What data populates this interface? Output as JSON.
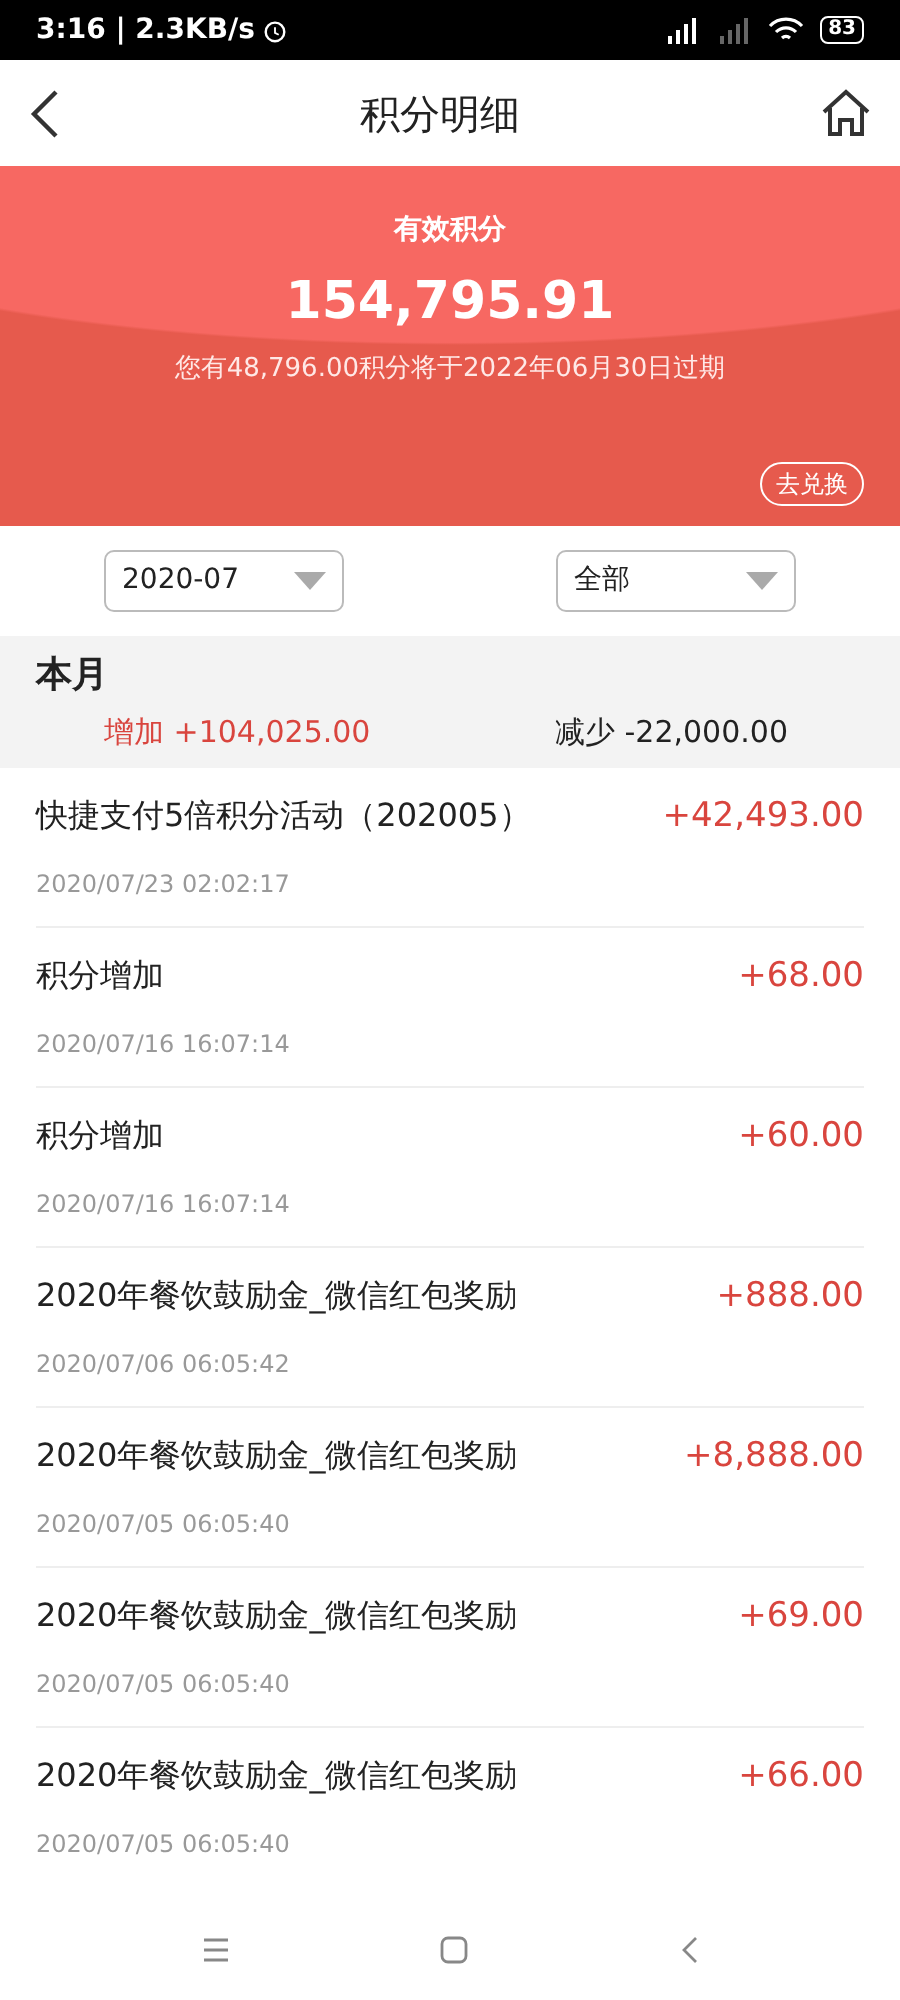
{
  "status_bar": {
    "time": "3:16 | 2.3KB/s",
    "battery": "83"
  },
  "header": {
    "title": "积分明细"
  },
  "banner": {
    "label": "有效积分",
    "points": "154,795.91",
    "expiry_note": "您有48,796.00积分将于2022年06月30日过期",
    "redeem_button": "去兑换"
  },
  "filters": [
    {
      "value": "2020-07"
    },
    {
      "value": "全部"
    }
  ],
  "month_summary": {
    "title": "本月",
    "increase": "增加 +104,025.00",
    "decrease": "减少 -22,000.00"
  },
  "transactions": [
    {
      "title": "快捷支付5倍积分活动（202005）",
      "amount": "+42,493.00",
      "time": "2020/07/23 02:02:17"
    },
    {
      "title": "积分增加",
      "amount": "+68.00",
      "time": "2020/07/16 16:07:14"
    },
    {
      "title": "积分增加",
      "amount": "+60.00",
      "time": "2020/07/16 16:07:14"
    },
    {
      "title": "2020年餐饮鼓励金_微信红包奖励",
      "amount": "+888.00",
      "time": "2020/07/06 06:05:42"
    },
    {
      "title": "2020年餐饮鼓励金_微信红包奖励",
      "amount": "+8,888.00",
      "time": "2020/07/05 06:05:40"
    },
    {
      "title": "2020年餐饮鼓励金_微信红包奖励",
      "amount": "+69.00",
      "time": "2020/07/05 06:05:40"
    },
    {
      "title": "2020年餐饮鼓励金_微信红包奖励",
      "amount": "+66.00",
      "time": "2020/07/05 06:05:40"
    }
  ]
}
